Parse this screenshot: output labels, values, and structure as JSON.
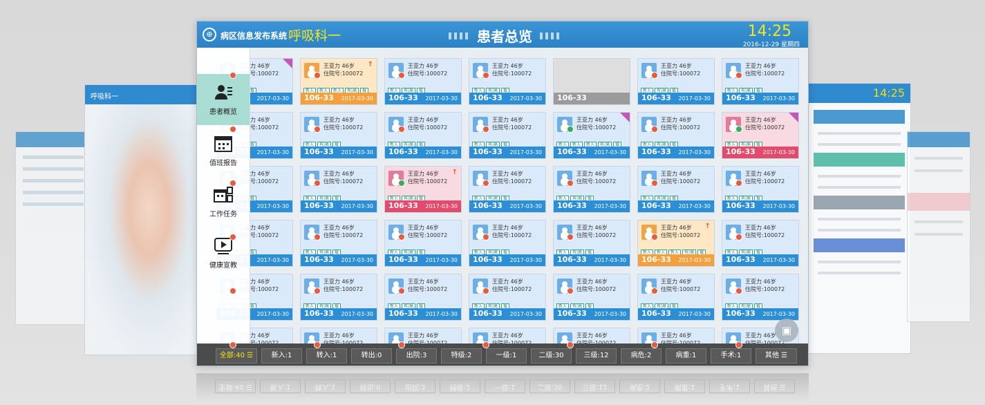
{
  "header": {
    "system_name": "病区信息发布系统",
    "department": "呼吸科一",
    "title": "患者总览",
    "time": "14:25",
    "date": "2016-12-29 星期四"
  },
  "sidebar": [
    {
      "label": "患者概览",
      "icon": "patient-list-icon",
      "active": true
    },
    {
      "label": "值班报告",
      "icon": "calendar-icon",
      "active": false
    },
    {
      "label": "工作任务",
      "icon": "task-board-icon",
      "active": false
    },
    {
      "label": "健康宣教",
      "icon": "video-play-icon",
      "active": false
    }
  ],
  "card_defaults": {
    "name": "王亚力 46岁",
    "admission": "住院号:100072",
    "bed": "106-33",
    "date": "2017-03-30"
  },
  "card_rows": [
    [
      {
        "tone": "blue",
        "tags": [
          "新入",
          "有|高",
          "载"
        ],
        "dot": "red",
        "flag": "corner"
      },
      {
        "tone": "orange",
        "tags": [
          "新入",
          "新入",
          "新入",
          "有|高",
          "载"
        ],
        "dot": "red",
        "flag": "arrow"
      },
      {
        "tone": "blue",
        "tags": [
          "新入",
          "有|高",
          "载"
        ],
        "dot": "red"
      },
      {
        "tone": "blue",
        "tags": [
          "新入",
          "有|高",
          "载"
        ],
        "dot": "red"
      },
      {
        "tone": "gray",
        "empty": true
      },
      {
        "tone": "blue",
        "tags": [
          "新入",
          "有|高",
          "载"
        ],
        "dot": "red"
      },
      {
        "tone": "blue",
        "tags": [
          "新入",
          "有|高",
          "载"
        ],
        "dot": "red"
      }
    ],
    [
      {
        "tone": "blue",
        "tags": [
          "新入",
          "有|高",
          "载"
        ],
        "dot": "red"
      },
      {
        "tone": "blue",
        "tags": [
          "新入",
          "有|高",
          "载"
        ],
        "dot": "red"
      },
      {
        "tone": "blue",
        "tags": [
          "新入",
          "有|高",
          "载"
        ],
        "dot": "red"
      },
      {
        "tone": "blue",
        "tags": [
          "新入",
          "有|高",
          "载"
        ],
        "dot": "red"
      },
      {
        "tone": "blue",
        "tags": [
          "新入",
          "新入",
          "新入",
          "有|高",
          "载"
        ],
        "dot": "green",
        "flag": "corner"
      },
      {
        "tone": "blue",
        "tags": [
          "新入",
          "有|高",
          "载"
        ],
        "dot": "red"
      },
      {
        "tone": "pink",
        "tags": [
          "新入",
          "有|高",
          "载"
        ],
        "dot": "green",
        "flag": "corner"
      }
    ],
    [
      {
        "tone": "blue",
        "tags": [
          "新入",
          "有|高",
          "载"
        ],
        "dot": "red"
      },
      {
        "tone": "blue",
        "tags": [
          "新入",
          "有|高",
          "载"
        ],
        "dot": "red"
      },
      {
        "tone": "pink",
        "tags": [
          "新入",
          "有|高",
          "载"
        ],
        "dot": "green",
        "flag": "arrow"
      },
      {
        "tone": "blue",
        "tags": [
          "新入",
          "有|高",
          "载"
        ],
        "dot": "red"
      },
      {
        "tone": "blue",
        "tags": [
          "新入",
          "有|高",
          "载"
        ],
        "dot": "red"
      },
      {
        "tone": "blue",
        "tags": [
          "新入",
          "有|高",
          "载"
        ],
        "dot": "red"
      },
      {
        "tone": "blue",
        "tags": [
          "新入",
          "有|高",
          "载"
        ],
        "dot": "red"
      }
    ],
    [
      {
        "tone": "blue",
        "tags": [
          "新入",
          "有|高",
          "载"
        ],
        "dot": "red"
      },
      {
        "tone": "blue",
        "tags": [
          "新入",
          "有|高",
          "载"
        ],
        "dot": "red"
      },
      {
        "tone": "blue",
        "tags": [
          "新入",
          "有|高",
          "载"
        ],
        "dot": "red"
      },
      {
        "tone": "blue",
        "tags": [
          "新入",
          "有|高",
          "载"
        ],
        "dot": "red"
      },
      {
        "tone": "blue",
        "tags": [
          "新入",
          "有|高",
          "载"
        ],
        "dot": "red"
      },
      {
        "tone": "orange",
        "tags": [
          "新入",
          "新入",
          "新入",
          "有|高",
          "载"
        ],
        "dot": "red",
        "flag": "arrow"
      },
      {
        "tone": "blue",
        "tags": [
          "新入",
          "有|高",
          "载"
        ],
        "dot": "red"
      }
    ],
    [
      {
        "tone": "blue",
        "tags": [
          "新入",
          "有|高",
          "载"
        ],
        "dot": "red"
      },
      {
        "tone": "blue",
        "tags": [
          "新入",
          "有|高",
          "载"
        ],
        "dot": "red"
      },
      {
        "tone": "blue",
        "tags": [
          "新入",
          "有|高",
          "载"
        ],
        "dot": "red"
      },
      {
        "tone": "blue",
        "tags": [
          "新入",
          "有|高",
          "载"
        ],
        "dot": "red"
      },
      {
        "tone": "blue",
        "tags": [
          "新入",
          "有|高",
          "载"
        ],
        "dot": "red"
      },
      {
        "tone": "blue",
        "tags": [
          "新入",
          "有|高",
          "载"
        ],
        "dot": "red"
      },
      {
        "tone": "blue",
        "tags": [
          "新入",
          "有|高",
          "载"
        ],
        "dot": "red"
      }
    ],
    [
      {
        "tone": "blue",
        "tags": [],
        "dot": "red"
      },
      {
        "tone": "blue",
        "tags": [],
        "dot": "red"
      },
      {
        "tone": "blue",
        "tags": [],
        "dot": "red"
      },
      {
        "tone": "blue",
        "tags": [],
        "dot": "red"
      },
      {
        "tone": "blue",
        "tags": [],
        "dot": "red"
      },
      {
        "tone": "blue",
        "tags": [],
        "dot": "red"
      },
      {
        "tone": "blue",
        "tags": [],
        "dot": "red"
      }
    ]
  ],
  "footer": [
    "全部:40 ☰",
    "新入:1",
    "转入:1",
    "转出:0",
    "出院:3",
    "特级:2",
    "一级:1",
    "二级:30",
    "三级:12",
    "病危:2",
    "病重:1",
    "手术:1",
    "其他 ☰"
  ],
  "feedback_icon": "chat-icon",
  "colors": {
    "header": "#2b82c6",
    "accent_yellow": "#f6e51a",
    "card_blue": "#2c8ed5",
    "card_orange": "#f4a03c",
    "card_pink": "#e34a6c"
  }
}
